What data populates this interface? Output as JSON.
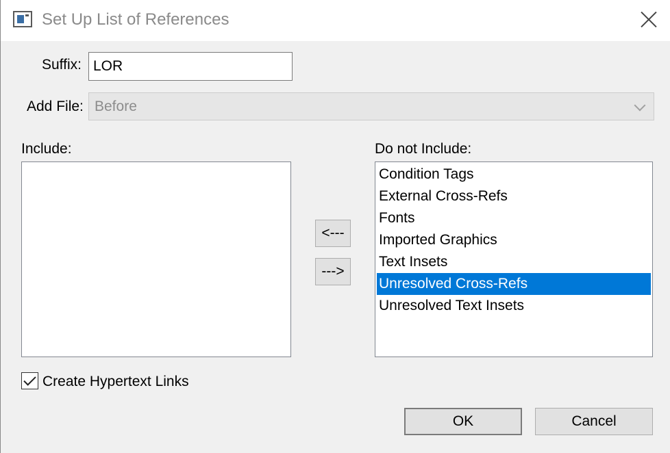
{
  "window": {
    "title": "Set Up List of References",
    "app_icon": "window-app-icon",
    "close_icon": "close-icon"
  },
  "suffix": {
    "label": "Suffix:",
    "value": "LOR"
  },
  "add_file": {
    "label": "Add File:",
    "selected": "Before",
    "disabled": true
  },
  "include": {
    "label": "Include:",
    "items": []
  },
  "do_not_include": {
    "label": "Do not Include:",
    "items": [
      "Condition Tags",
      "External Cross-Refs",
      "Fonts",
      "Imported Graphics",
      "Text Insets",
      "Unresolved Cross-Refs",
      "Unresolved Text Insets"
    ],
    "selected_index": 5
  },
  "move_buttons": {
    "left": "<---",
    "right": "--->"
  },
  "hypertext": {
    "label": "Create Hypertext Links",
    "checked": true
  },
  "buttons": {
    "ok": "OK",
    "cancel": "Cancel"
  },
  "colors": {
    "selection": "#0078d7",
    "dialog_bg": "#f0f0f0",
    "title_text": "#8a8a8a"
  }
}
